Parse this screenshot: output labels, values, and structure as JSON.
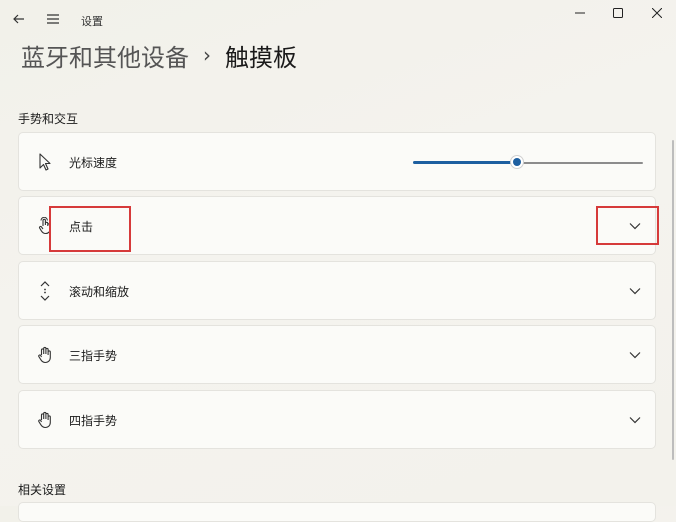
{
  "window": {
    "title": "设置"
  },
  "breadcrumb": {
    "parent": "蓝牙和其他设备",
    "separator": "›",
    "current": "触摸板"
  },
  "section_gestures": "手势和交互",
  "cards": [
    {
      "label": "光标速度",
      "icon": "cursor-icon"
    },
    {
      "label": "点击",
      "icon": "tap-hand-icon"
    },
    {
      "label": "滚动和缩放",
      "icon": "scroll-icon"
    },
    {
      "label": "三指手势",
      "icon": "hand-icon"
    },
    {
      "label": "四指手势",
      "icon": "hand-icon"
    }
  ],
  "cursor_speed": {
    "value_fraction": 0.45
  },
  "section_related": "相关设置",
  "colors": {
    "accent": "#1d5fa0",
    "highlight": "#d63a3a"
  }
}
